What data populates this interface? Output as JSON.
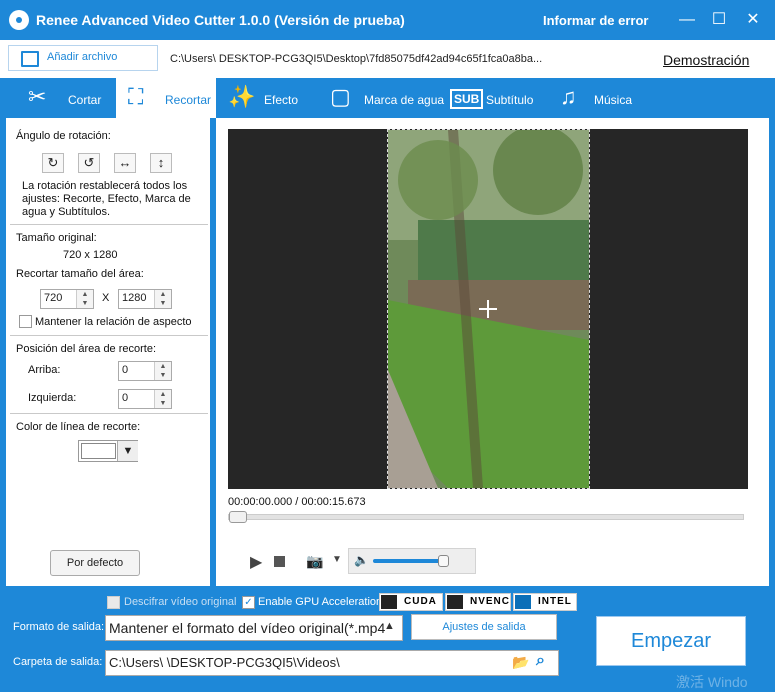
{
  "window": {
    "title": "Renee Advanced Video Cutter 1.0.0 (Versión de prueba)",
    "report_error": "Informar de error",
    "minimize": "—",
    "maximize": "☐",
    "close": "✕"
  },
  "filebar": {
    "add_file": "Añadir archivo",
    "path": "C:\\Users\\      DESKTOP-PCG3QI5\\Desktop\\7fd85075df42ad94c65f1fca0a8ba...",
    "demo": "Demostración"
  },
  "tabs": [
    {
      "label": "Cortar",
      "icon": "✂",
      "active": false
    },
    {
      "label": "Recortar",
      "icon": "⛶",
      "active": true
    },
    {
      "label": "Efecto",
      "icon": "✨",
      "active": false
    },
    {
      "label": "Marca de agua",
      "icon": "▢",
      "active": false
    },
    {
      "label": "Subtítulo",
      "icon": "SUB",
      "active": false
    },
    {
      "label": "Música",
      "icon": "♫",
      "active": false
    }
  ],
  "crop": {
    "rotation_label": "Ángulo de rotación:",
    "rotate_cw": "↻",
    "rotate_ccw": "↺",
    "flip_h": "↔",
    "flip_v": "↕",
    "rotation_note": "La rotación restablecerá todos los ajustes: Recorte, Efecto, Marca de agua y Subtítulos.",
    "original_size_label": "Tamaño original:",
    "original_size": "720 x 1280",
    "crop_size_label": "Recortar tamaño del área:",
    "width": "720",
    "height": "1280",
    "x_sep": "X",
    "keep_ratio": "Mantener la relación de aspecto",
    "position_label": "Posición del área de recorte:",
    "top_label": "Arriba:",
    "top_value": "0",
    "left_label": "Izquierda:",
    "left_value": "0",
    "line_color_label": "Color de línea de recorte:",
    "default_button": "Por defecto"
  },
  "player": {
    "timecode": "00:00:00.000 / 00:00:15.673",
    "play": "▶",
    "camera": "📷",
    "dropdown": "▼",
    "volume_icon": "🔈",
    "volume_level": 0.85,
    "progress": 0
  },
  "bottom": {
    "decrypt": "Descifrar vídeo original",
    "gpu": "Enable GPU Acceleration",
    "cuda": "CUDA",
    "nvenc": "NVENC",
    "intel": "INTEL",
    "format_label": "Formato de salida:",
    "format_value": "Mantener el formato del vídeo original(*.mp4",
    "output_settings": "Ajustes de salida",
    "folder_label": "Carpeta de salida:",
    "folder_value": "C:\\Users\\      \\DESKTOP-PCG3QI5\\Videos\\",
    "start": "Empezar",
    "watermark_text": "激活 Windo"
  },
  "colors": {
    "accent": "#1e88d8",
    "video_bg": "#262626"
  }
}
